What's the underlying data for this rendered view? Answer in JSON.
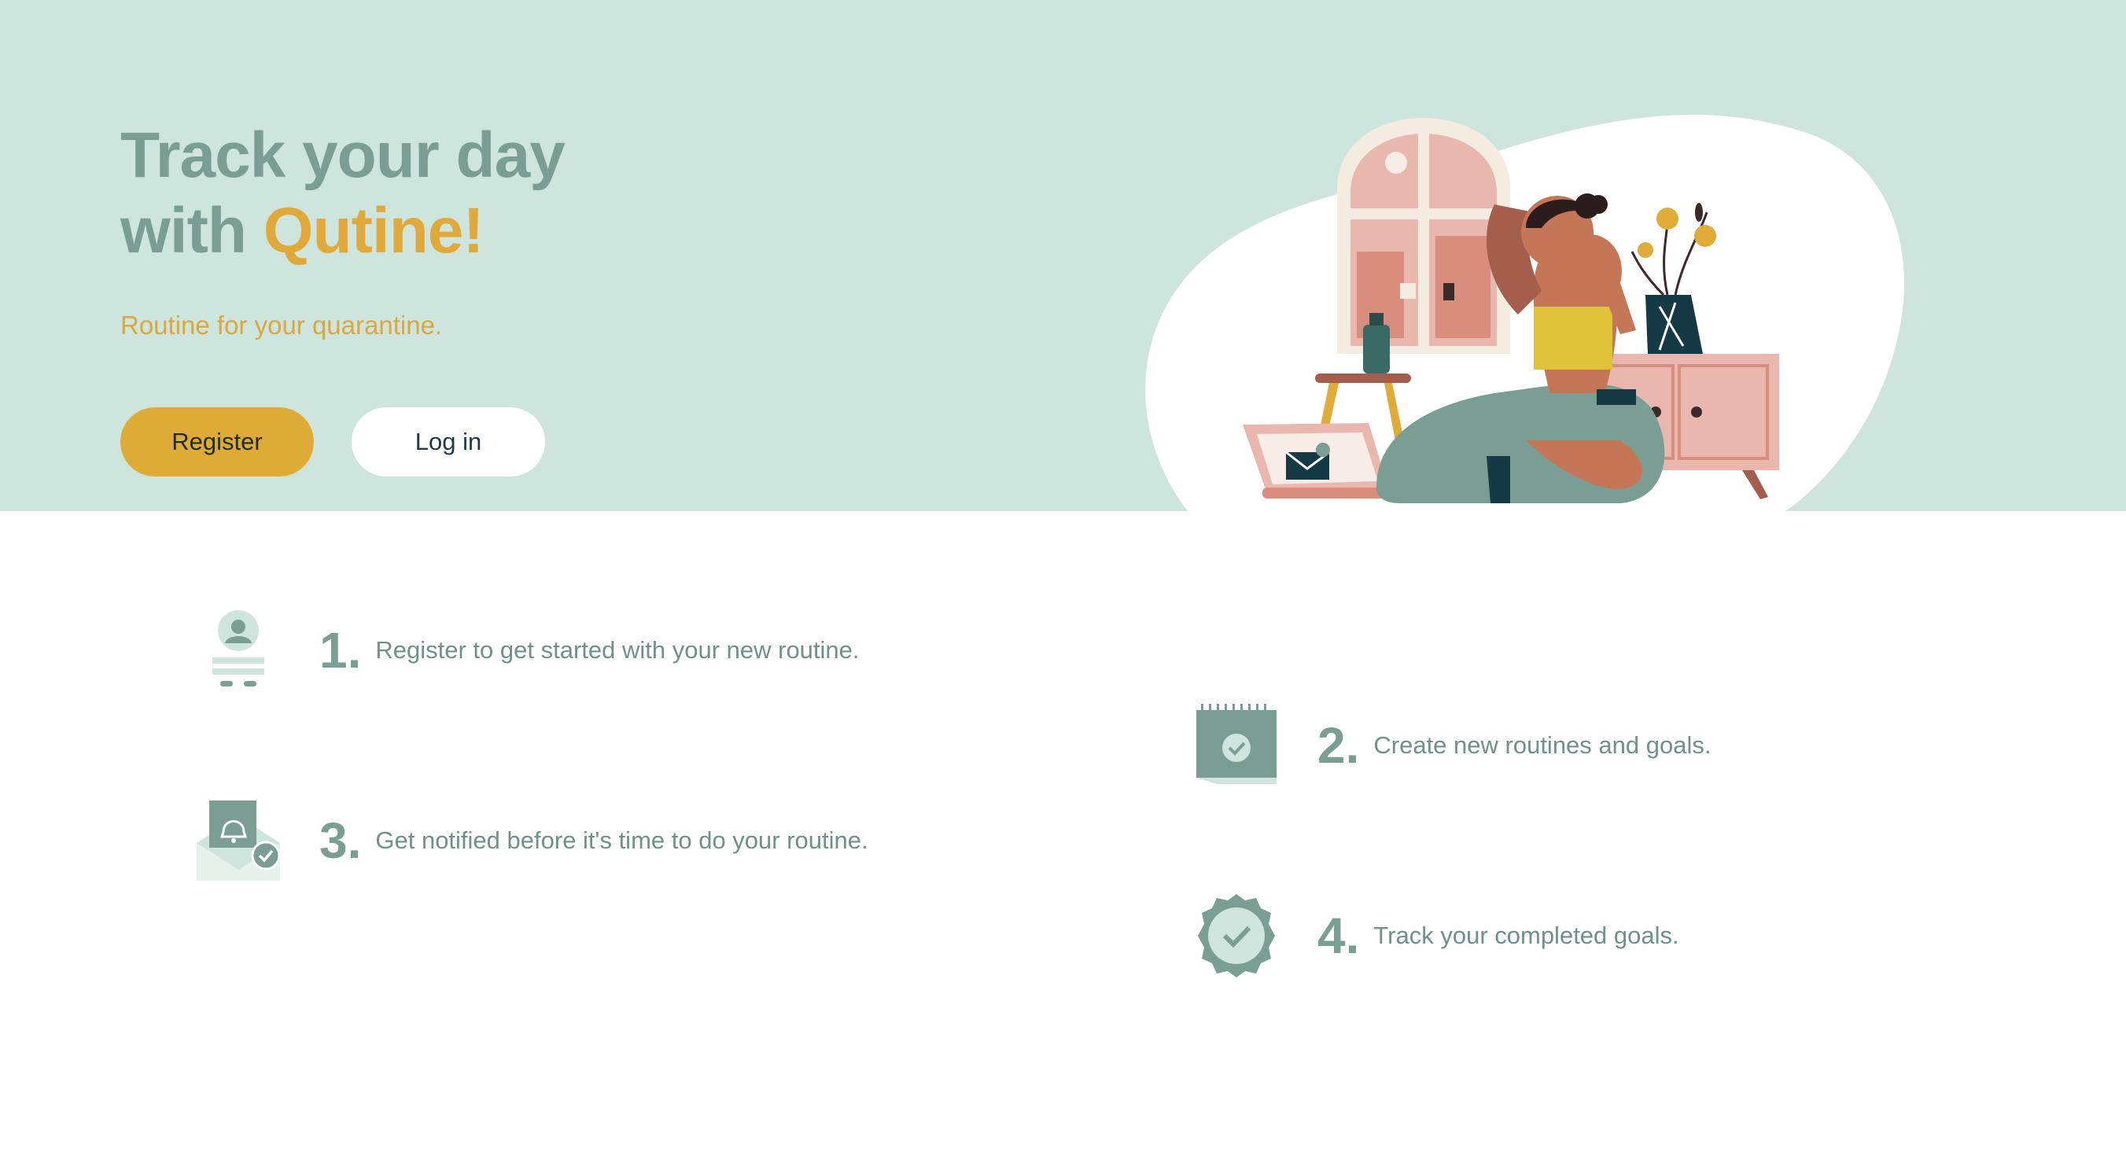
{
  "hero": {
    "title_line1": "Track your day",
    "title_line2_prefix": "with ",
    "title_brand": "Qutine!",
    "subtitle": "Routine for your quarantine.",
    "register_label": "Register",
    "login_label": "Log in"
  },
  "steps": [
    {
      "number": "1.",
      "text": "Register to get started with your new routine.",
      "icon": "user-profile-icon"
    },
    {
      "number": "2.",
      "text": "Create new routines and goals.",
      "icon": "calendar-check-icon"
    },
    {
      "number": "3.",
      "text": "Get notified before it's time to do your routine.",
      "icon": "notification-envelope-icon"
    },
    {
      "number": "4.",
      "text": "Track your completed goals.",
      "icon": "badge-check-icon"
    }
  ],
  "colors": {
    "hero_background": "#cde5dc",
    "title": "#7a9e93",
    "brand_accent": "#e0a93a",
    "register_button": "#dfab37",
    "step_text": "#6f918a"
  }
}
